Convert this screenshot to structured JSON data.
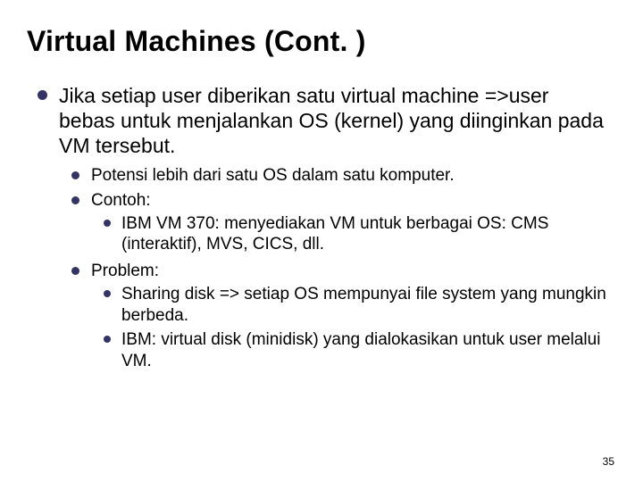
{
  "title": "Virtual Machines (Cont. )",
  "bullets": {
    "l1": "Jika setiap user diberikan satu virtual machine =>user bebas untuk menjalankan OS (kernel) yang diinginkan pada VM tersebut.",
    "l2a": "Potensi lebih dari satu OS dalam satu komputer.",
    "l2b": "Contoh:",
    "l2b_l3a": "IBM VM 370: menyediakan VM untuk berbagai OS: CMS (interaktif), MVS, CICS, dll.",
    "l2c": "Problem:",
    "l2c_l3a": "Sharing disk => setiap OS mempunyai file system yang mungkin berbeda.",
    "l2c_l3b": "IBM: virtual disk (minidisk) yang dialokasikan untuk user melalui VM."
  },
  "page_number": "35"
}
